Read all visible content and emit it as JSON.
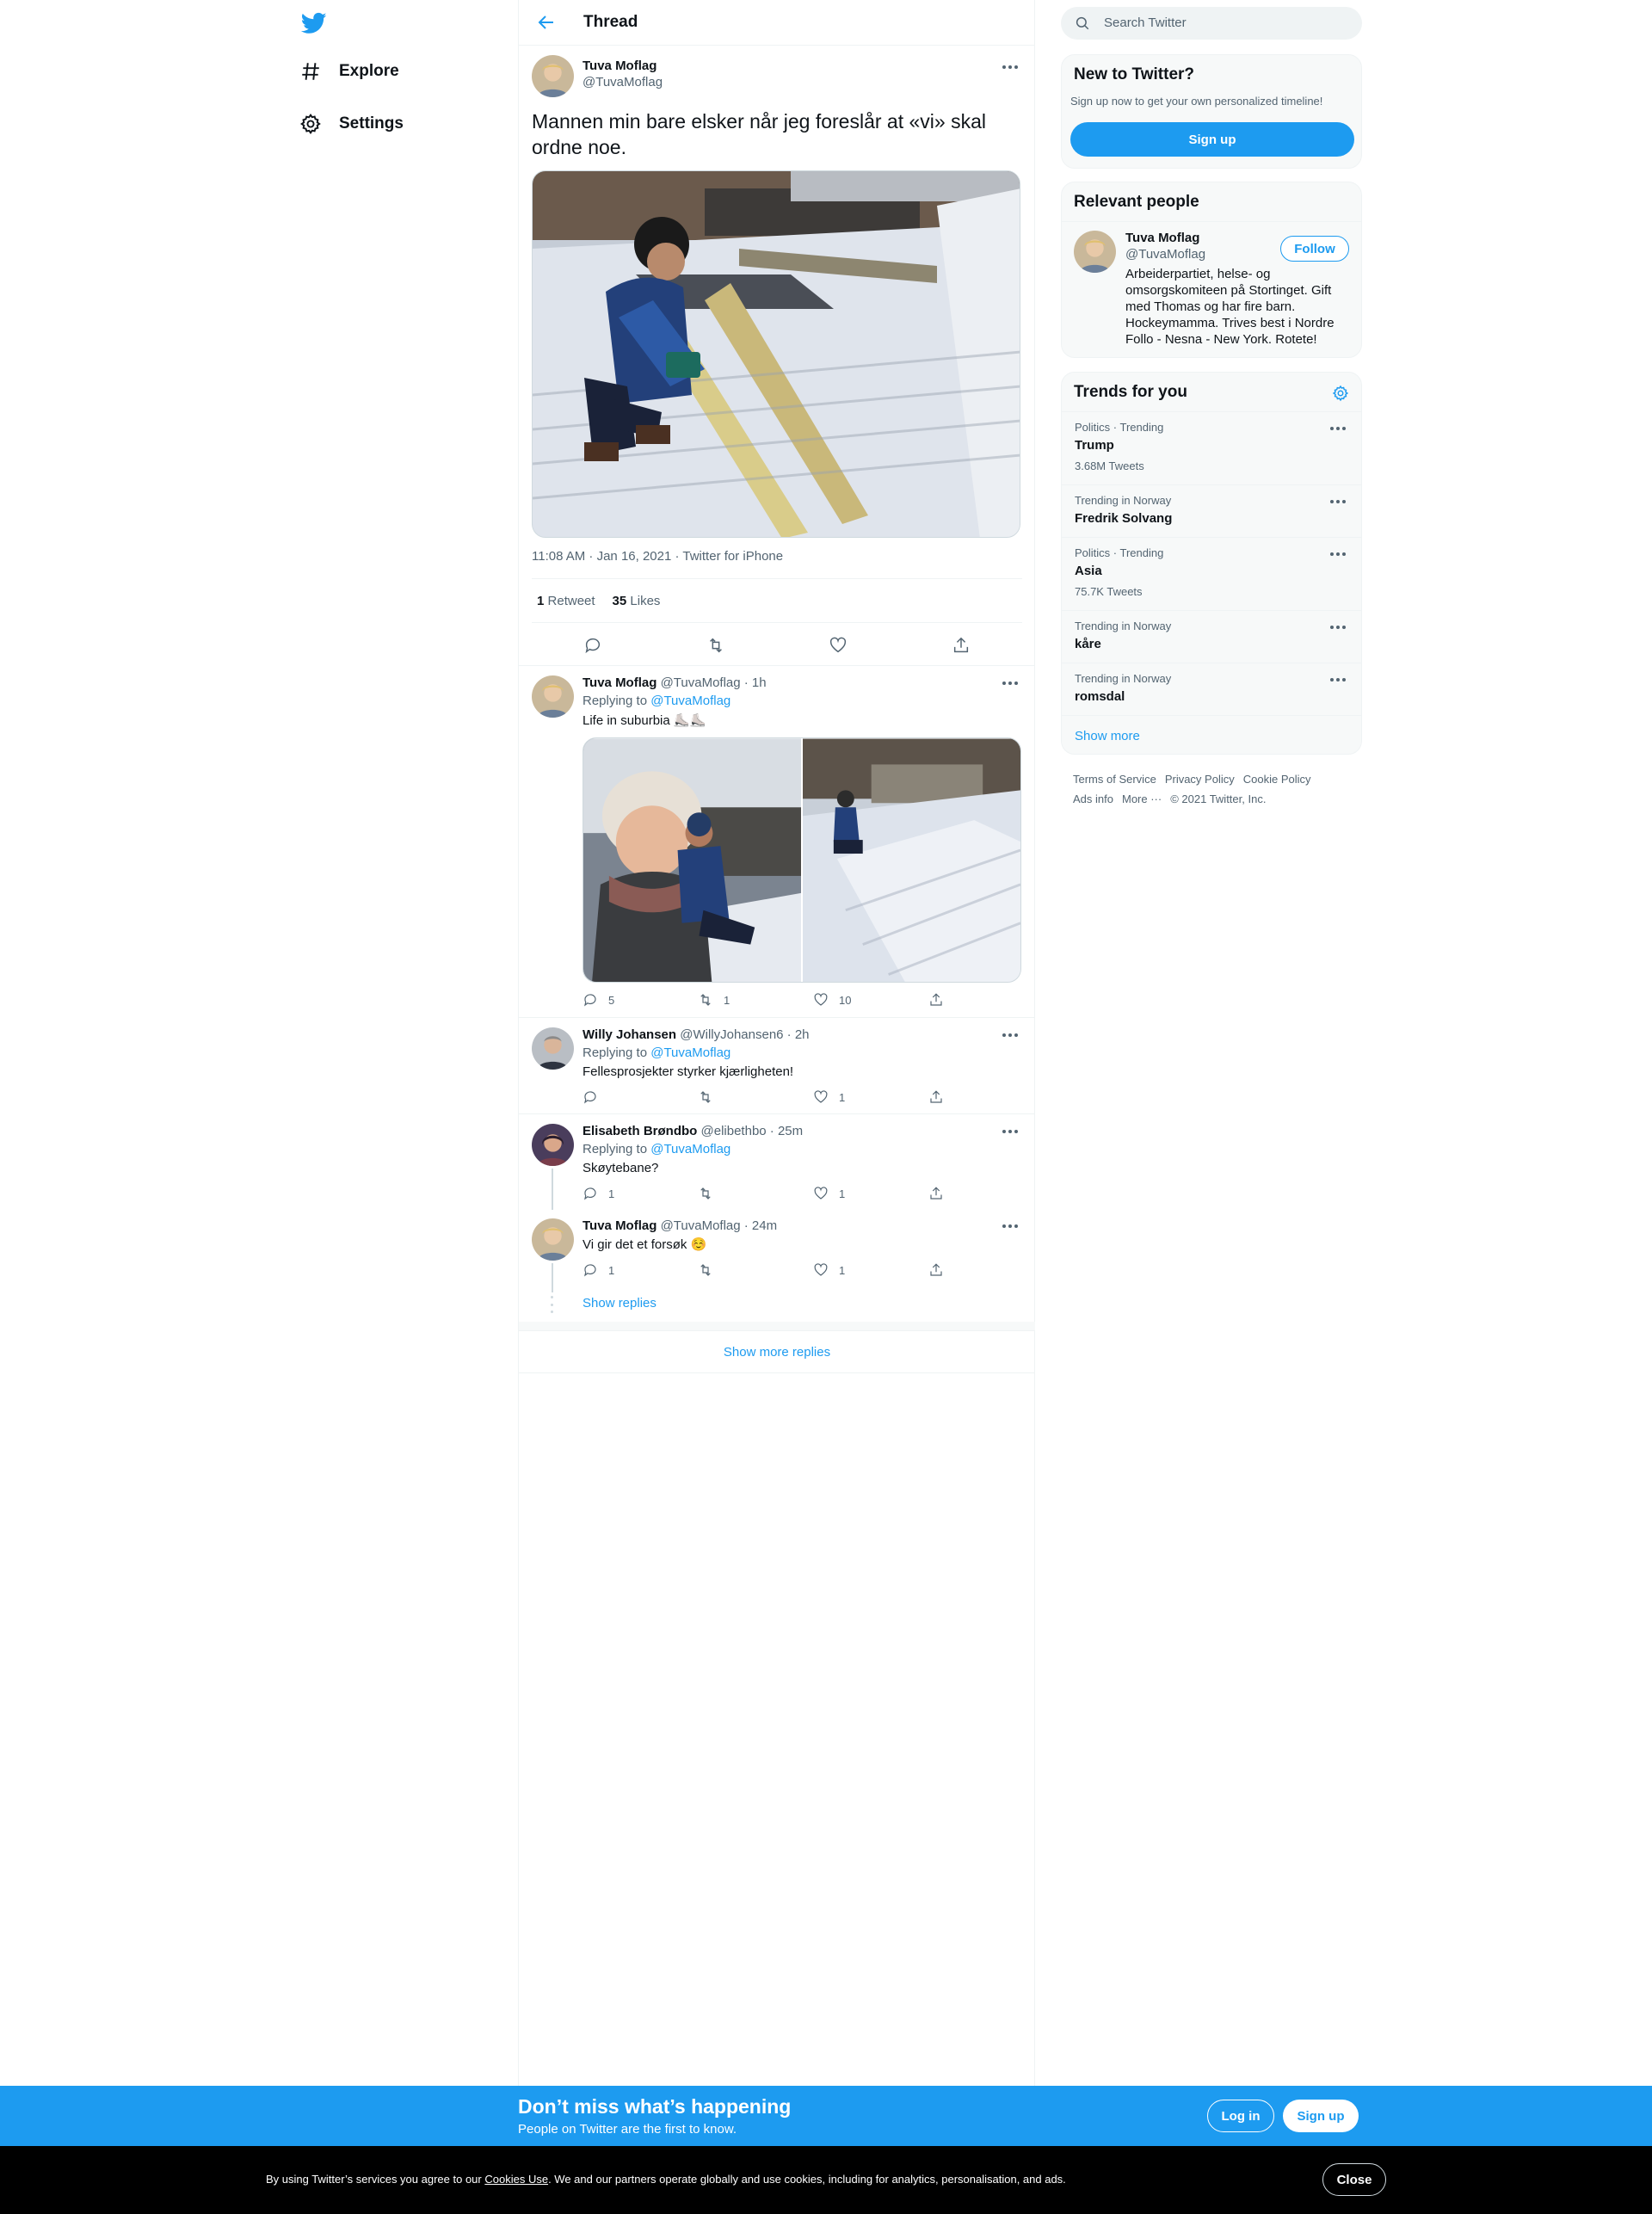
{
  "nav": {
    "items": [
      {
        "label": "Explore",
        "icon": "hashtag-icon"
      },
      {
        "label": "Settings",
        "icon": "gear-icon"
      }
    ]
  },
  "header": {
    "title": "Thread"
  },
  "focal": {
    "name": "Tuva Moflag",
    "handle": "@TuvaMoflag",
    "text": "Mannen min bare elsker når jeg foreslår at «vi» skal ordne noe.",
    "meta": "11:08 AM · Jan 16, 2021 · Twitter for iPhone",
    "retweets_count": "1",
    "retweets_label": "Retweet",
    "likes_count": "35",
    "likes_label": "Likes"
  },
  "replies": [
    {
      "name": "Tuva Moflag",
      "handle": "@TuvaMoflag · 1h",
      "replying_prefix": "Replying to",
      "replying_to": "@TuvaMoflag",
      "text": "Life in suburbia ⛸️⛸️",
      "replies": "5",
      "retweets": "1",
      "likes": "10"
    },
    {
      "name": "Willy Johansen",
      "handle": "@WillyJohansen6 · 2h",
      "replying_prefix": "Replying to",
      "replying_to": "@TuvaMoflag",
      "text": "Fellesprosjekter styrker kjærligheten!",
      "replies": "",
      "retweets": "",
      "likes": "1"
    },
    {
      "name": "Elisabeth Brøndbo",
      "handle": "@elibethbo · 25m",
      "replying_prefix": "Replying to",
      "replying_to": "@TuvaMoflag",
      "text": "Skøytebane?",
      "replies": "1",
      "retweets": "",
      "likes": "1"
    },
    {
      "name": "Tuva Moflag",
      "handle": "@TuvaMoflag · 24m",
      "text": "Vi gir det et forsøk ☺️",
      "replies": "1",
      "retweets": "",
      "likes": "1"
    }
  ],
  "show_replies": "Show replies",
  "show_more_replies": "Show more replies",
  "search": {
    "placeholder": "Search Twitter"
  },
  "new_to_twitter": {
    "title": "New to Twitter?",
    "subtitle": "Sign up now to get your own personalized timeline!",
    "button": "Sign up"
  },
  "relevant": {
    "title": "Relevant people",
    "name": "Tuva Moflag",
    "handle": "@TuvaMoflag",
    "follow": "Follow",
    "bio": "Arbeiderpartiet, helse- og omsorgskomiteen på Stortinget. Gift med Thomas og har fire barn. Hockeymamma. Trives best i Nordre Follo - Nesna - New York. Rotete!"
  },
  "trends": {
    "title": "Trends for you",
    "items": [
      {
        "category": "Politics · Trending",
        "name": "Trump",
        "count": "3.68M Tweets"
      },
      {
        "category": "Trending in Norway",
        "name": "Fredrik Solvang",
        "count": ""
      },
      {
        "category": "Politics · Trending",
        "name": "Asia",
        "count": "75.7K Tweets"
      },
      {
        "category": "Trending in Norway",
        "name": "kåre",
        "count": ""
      },
      {
        "category": "Trending in Norway",
        "name": "romsdal",
        "count": ""
      }
    ],
    "show_more": "Show more"
  },
  "footer": {
    "links": [
      "Terms of Service",
      "Privacy Policy",
      "Cookie Policy"
    ],
    "links2": [
      "Ads info",
      "More ···",
      "© 2021 Twitter, Inc."
    ]
  },
  "promo": {
    "title": "Don’t miss what’s happening",
    "subtitle": "People on Twitter are the first to know.",
    "login": "Log in",
    "signup": "Sign up"
  },
  "cookie": {
    "text_before": "By using Twitter’s services you agree to our ",
    "link": "Cookies Use",
    "text_after": ". We and our partners operate globally and use cookies, including for analytics, personalisation, and ads.",
    "close": "Close"
  },
  "colors": {
    "accent": "#1d9bf0",
    "text": "#0f1419",
    "muted": "#536471",
    "promo_bg": "#1d9bf0",
    "cookie_bg": "#000000"
  }
}
